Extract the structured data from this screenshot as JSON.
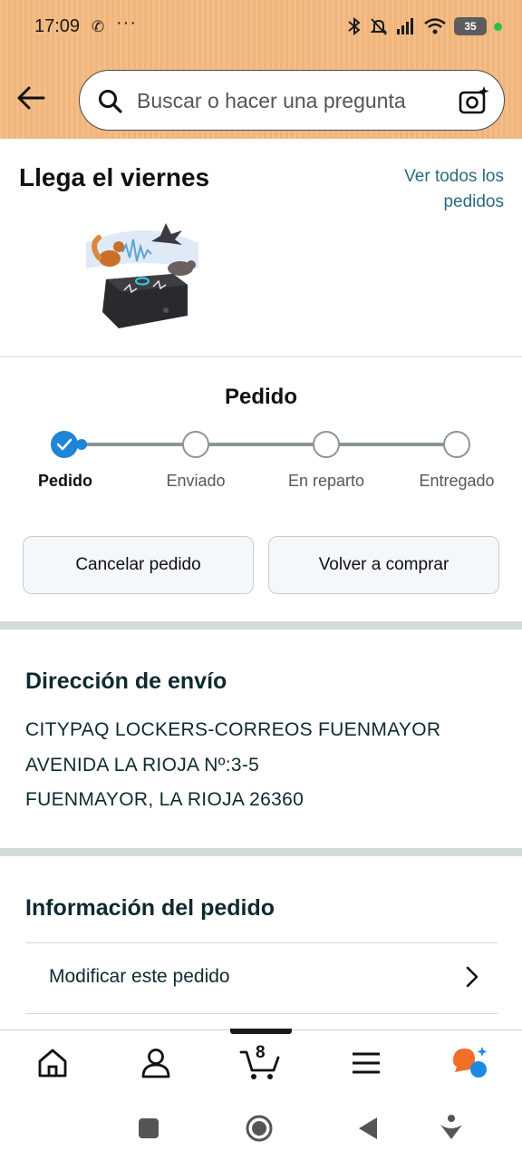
{
  "status_bar": {
    "time": "17:09",
    "call_glyph": "✆",
    "more_glyph": "···",
    "battery": "35"
  },
  "header": {
    "search_placeholder": "Buscar o hacer una pregunta"
  },
  "arrival": {
    "title": "Llega el viernes",
    "all_orders_link": "Ver todos los pedidos"
  },
  "progress": {
    "title": "Pedido",
    "steps": [
      {
        "label": "Pedido",
        "state": "done"
      },
      {
        "label": "Enviado",
        "state": "pending"
      },
      {
        "label": "En reparto",
        "state": "pending"
      },
      {
        "label": "Entregado",
        "state": "pending"
      }
    ]
  },
  "actions": {
    "cancel": "Cancelar pedido",
    "rebuy": "Volver a comprar"
  },
  "shipping": {
    "title": "Dirección de envío",
    "lines": [
      "CITYPAQ LOCKERS-CORREOS FUENMAYOR",
      "AVENIDA LA RIOJA Nº:3-5",
      "FUENMAYOR, LA RIOJA 26360"
    ]
  },
  "order_info": {
    "title": "Información del pedido",
    "modify": "Modificar este pedido"
  },
  "bottom_nav": {
    "items": [
      "home-icon",
      "account-icon",
      "cart-icon",
      "menu-icon",
      "ai-assistant-icon"
    ],
    "cart_count": "8",
    "active": "cart-icon"
  },
  "colors": {
    "header": "#f3bd86",
    "accent": "#1f85d6",
    "link": "#2a6a80",
    "divider": "#d5dbdb"
  }
}
